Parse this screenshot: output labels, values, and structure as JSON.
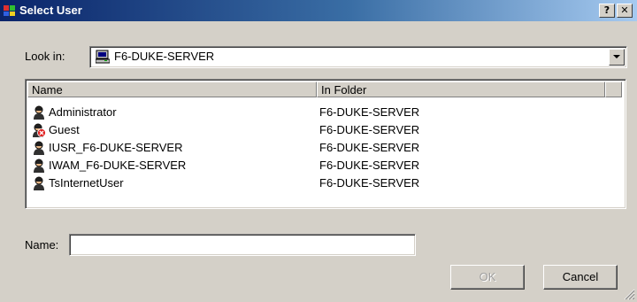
{
  "window": {
    "title": "Select User",
    "help_button": "?",
    "close_button": "✕"
  },
  "look_in": {
    "label": "Look in:",
    "value": "F6-DUKE-SERVER"
  },
  "list": {
    "columns": [
      "Name",
      "In Folder"
    ],
    "rows": [
      {
        "name": "Administrator",
        "folder": "F6-DUKE-SERVER",
        "icon": "user-icon"
      },
      {
        "name": "Guest",
        "folder": "F6-DUKE-SERVER",
        "icon": "disabled-user-icon"
      },
      {
        "name": "IUSR_F6-DUKE-SERVER",
        "folder": "F6-DUKE-SERVER",
        "icon": "user-icon"
      },
      {
        "name": "IWAM_F6-DUKE-SERVER",
        "folder": "F6-DUKE-SERVER",
        "icon": "user-icon"
      },
      {
        "name": "TsInternetUser",
        "folder": "F6-DUKE-SERVER",
        "icon": "user-icon"
      }
    ]
  },
  "name_field": {
    "label": "Name:",
    "value": ""
  },
  "buttons": {
    "ok": "OK",
    "cancel": "Cancel"
  },
  "colors": {
    "title_active": "#0a246a",
    "dialog_face": "#d4d0c8",
    "disabled_text": "#a0a0a0"
  }
}
